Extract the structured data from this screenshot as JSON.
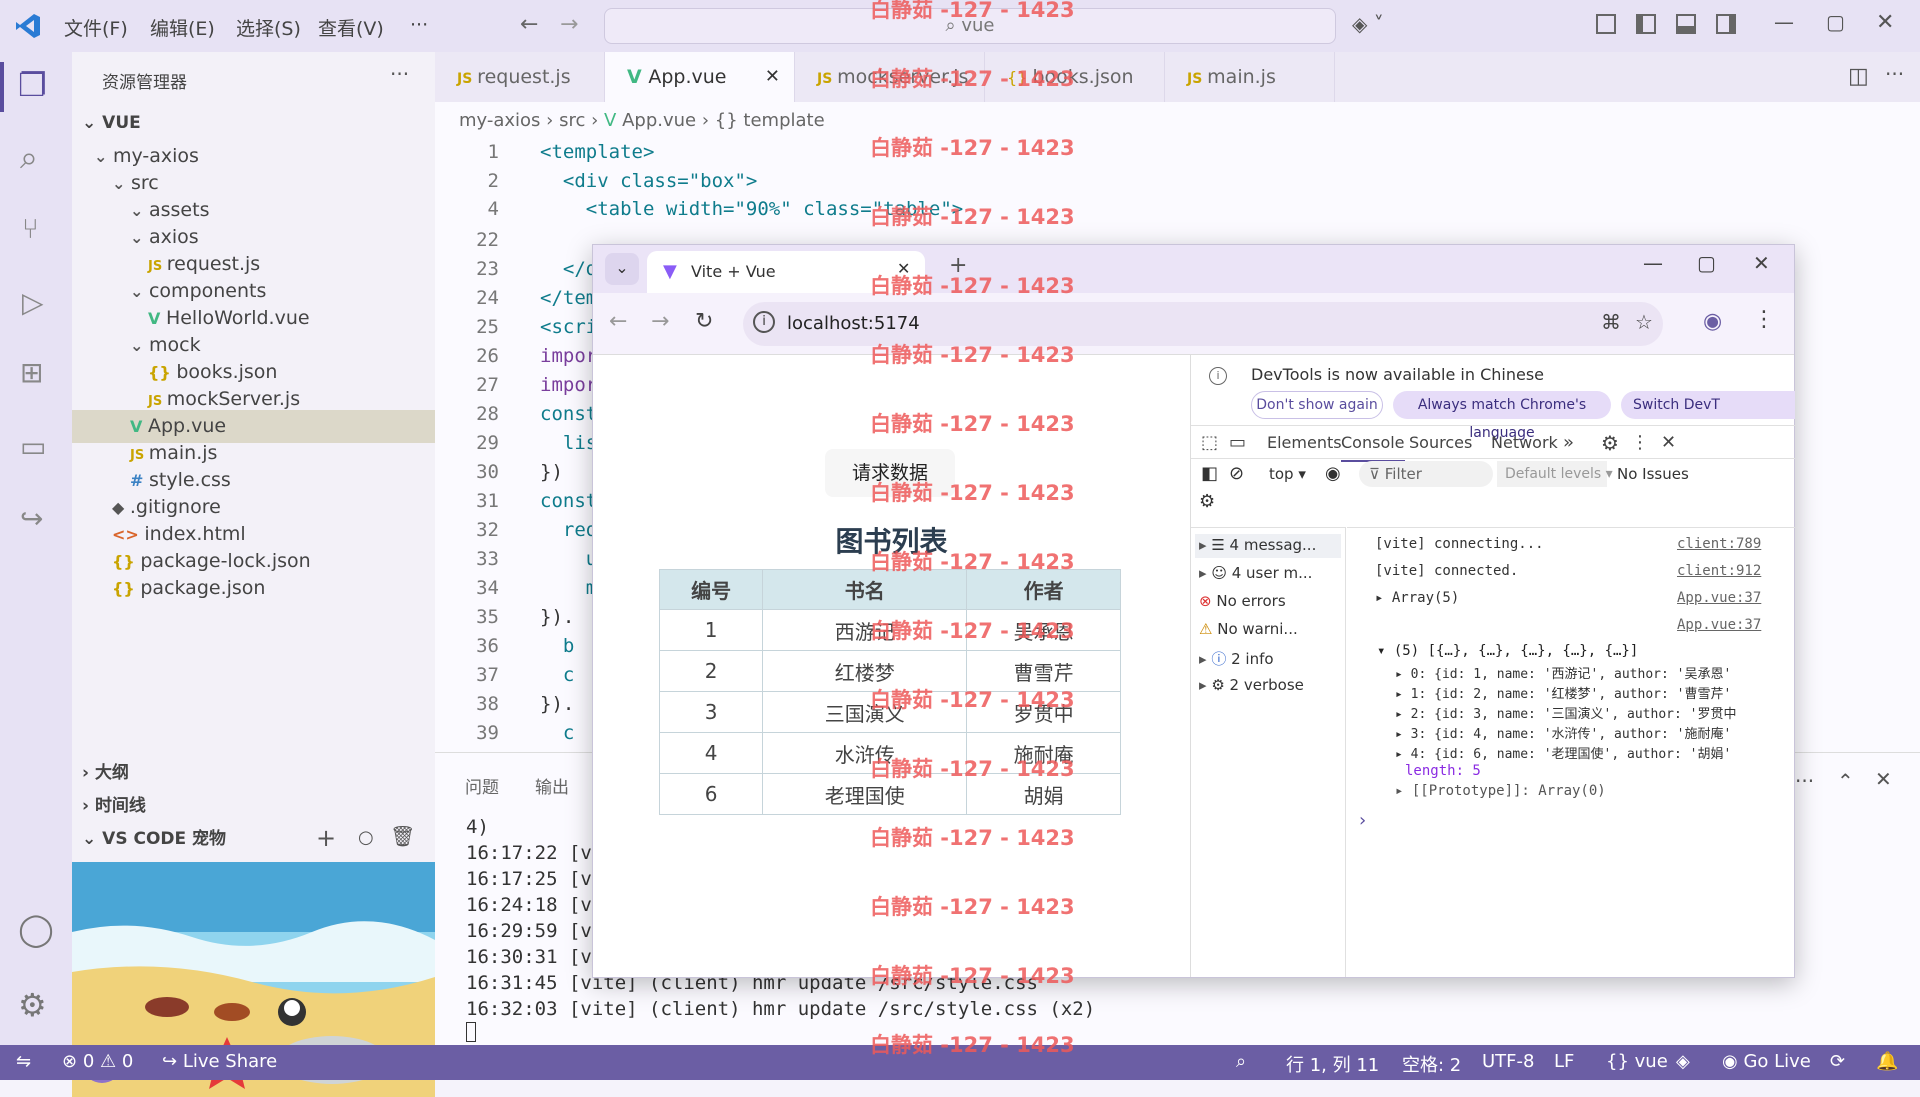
{
  "titlebar": {
    "menus": [
      "文件(F)",
      "编辑(E)",
      "选择(S)",
      "查看(V)",
      "···"
    ],
    "search": "vue"
  },
  "sidebar": {
    "title": "资源管理器",
    "root": "VUE",
    "tree": [
      {
        "label": "my-axios",
        "type": "folder"
      },
      {
        "label": "src",
        "type": "folder"
      },
      {
        "label": "assets",
        "type": "folder"
      },
      {
        "label": "axios",
        "type": "folder"
      },
      {
        "label": "request.js",
        "type": "js"
      },
      {
        "label": "components",
        "type": "folder"
      },
      {
        "label": "HelloWorld.vue",
        "type": "vue"
      },
      {
        "label": "mock",
        "type": "folder"
      },
      {
        "label": "books.json",
        "type": "json"
      },
      {
        "label": "mockServer.js",
        "type": "js"
      },
      {
        "label": "App.vue",
        "type": "vue"
      },
      {
        "label": "main.js",
        "type": "js"
      },
      {
        "label": "style.css",
        "type": "css"
      },
      {
        "label": ".gitignore",
        "type": "git"
      },
      {
        "label": "index.html",
        "type": "html"
      },
      {
        "label": "package-lock.json",
        "type": "json"
      },
      {
        "label": "package.json",
        "type": "json"
      }
    ],
    "outline": "大纲",
    "timeline": "时间线",
    "pet": "VS CODE 宠物"
  },
  "tabs": [
    {
      "label": "request.js",
      "icon": "JS"
    },
    {
      "label": "App.vue",
      "icon": "V"
    },
    {
      "label": "mockserver.js",
      "icon": "JS"
    },
    {
      "label": "books.json",
      "icon": "{}"
    },
    {
      "label": "main.js",
      "icon": "JS"
    }
  ],
  "breadcrumb": [
    "my-axios",
    "src",
    "App.vue",
    "{} template"
  ],
  "editor": {
    "line_numbers": [
      "1",
      "2",
      "4",
      "22",
      "23",
      "24",
      "25",
      "26",
      "27",
      "28",
      "29",
      "30",
      "31",
      "32",
      "33",
      "34",
      "35",
      "36",
      "37",
      "38",
      "39"
    ],
    "lines": [
      "<template>",
      "  <div class=\"box\">",
      "    <table width=\"90%\" class=\"table\">",
      "",
      "  </d",
      "</tem",
      "<scri",
      "impor",
      "impor",
      "const",
      "  lis",
      "})",
      "const",
      "  req",
      "    u",
      "    m",
      "}).",
      "  b",
      "  c",
      "}).",
      "  c"
    ]
  },
  "panel": {
    "tabs": [
      "问题",
      "输出"
    ],
    "lines": [
      "4)",
      "16:17:22 [vi",
      "16:17:25 [vi",
      "16:24:18 [vi",
      "16:29:59 [vi",
      "16:30:31 [vi",
      "16:31:45 [vite] (client) hmr update /src/style.css",
      "16:32:03 [vite] (client) hmr update /src/style.css (x2)"
    ]
  },
  "status": {
    "errors": "0",
    "warnings": "0",
    "liveshare": "Live Share",
    "position": "行 1, 列 11",
    "spaces": "空格: 2",
    "encoding": "UTF-8",
    "eol": "LF",
    "language": "vue",
    "golive": "Go Live"
  },
  "browser": {
    "tab_title": "Vite + Vue",
    "url": "localhost:5174",
    "button": "请求数据",
    "heading": "图书列表",
    "columns": [
      "编号",
      "书名",
      "作者"
    ],
    "rows": [
      [
        "1",
        "西游记",
        "吴承恩"
      ],
      [
        "2",
        "红楼梦",
        "曹雪芹"
      ],
      [
        "3",
        "三国演义",
        "罗贯中"
      ],
      [
        "4",
        "水浒传",
        "施耐庵"
      ],
      [
        "6",
        "老理国使",
        "胡娟"
      ]
    ]
  },
  "devtools": {
    "banner": "DevTools is now available in Chinese",
    "banner_buttons": [
      "Don't show again",
      "Always match Chrome's language",
      "Switch DevT"
    ],
    "tabs": [
      "Elements",
      "Console",
      "Sources",
      "Network"
    ],
    "context": "top",
    "filter": "Filter",
    "levels": "Default levels",
    "issues": "No Issues",
    "sidebar": [
      "4 messag...",
      "4 user m...",
      "No errors",
      "No warni...",
      "2 info",
      "2 verbose"
    ],
    "console": [
      {
        "text": "[vite] connecting...",
        "src": "client:789"
      },
      {
        "text": "[vite] connected.",
        "src": "client:912"
      },
      {
        "text": "▸ Array(5)",
        "src": "App.vue:37"
      },
      {
        "text": "",
        "src": "App.vue:37"
      }
    ],
    "array_head": "▾ (5) [{…}, {…}, {…}, {…}, {…}]",
    "array_items": [
      "▸ 0: {id: 1, name: '西游记', author: '吴承恩'",
      "▸ 1: {id: 2, name: '红楼梦', author: '曹雪芹'",
      "▸ 2: {id: 3, name: '三国演义', author: '罗贯中",
      "▸ 3: {id: 4, name: '水浒传', author: '施耐庵'",
      "▸ 4: {id: 6, name: '老理国使', author: '胡娟'"
    ],
    "length": "length: 5",
    "prototype": "▸ [[Prototype]]: Array(0)",
    "prompt": "›"
  },
  "watermark": "白静茹 -127 - 1423"
}
